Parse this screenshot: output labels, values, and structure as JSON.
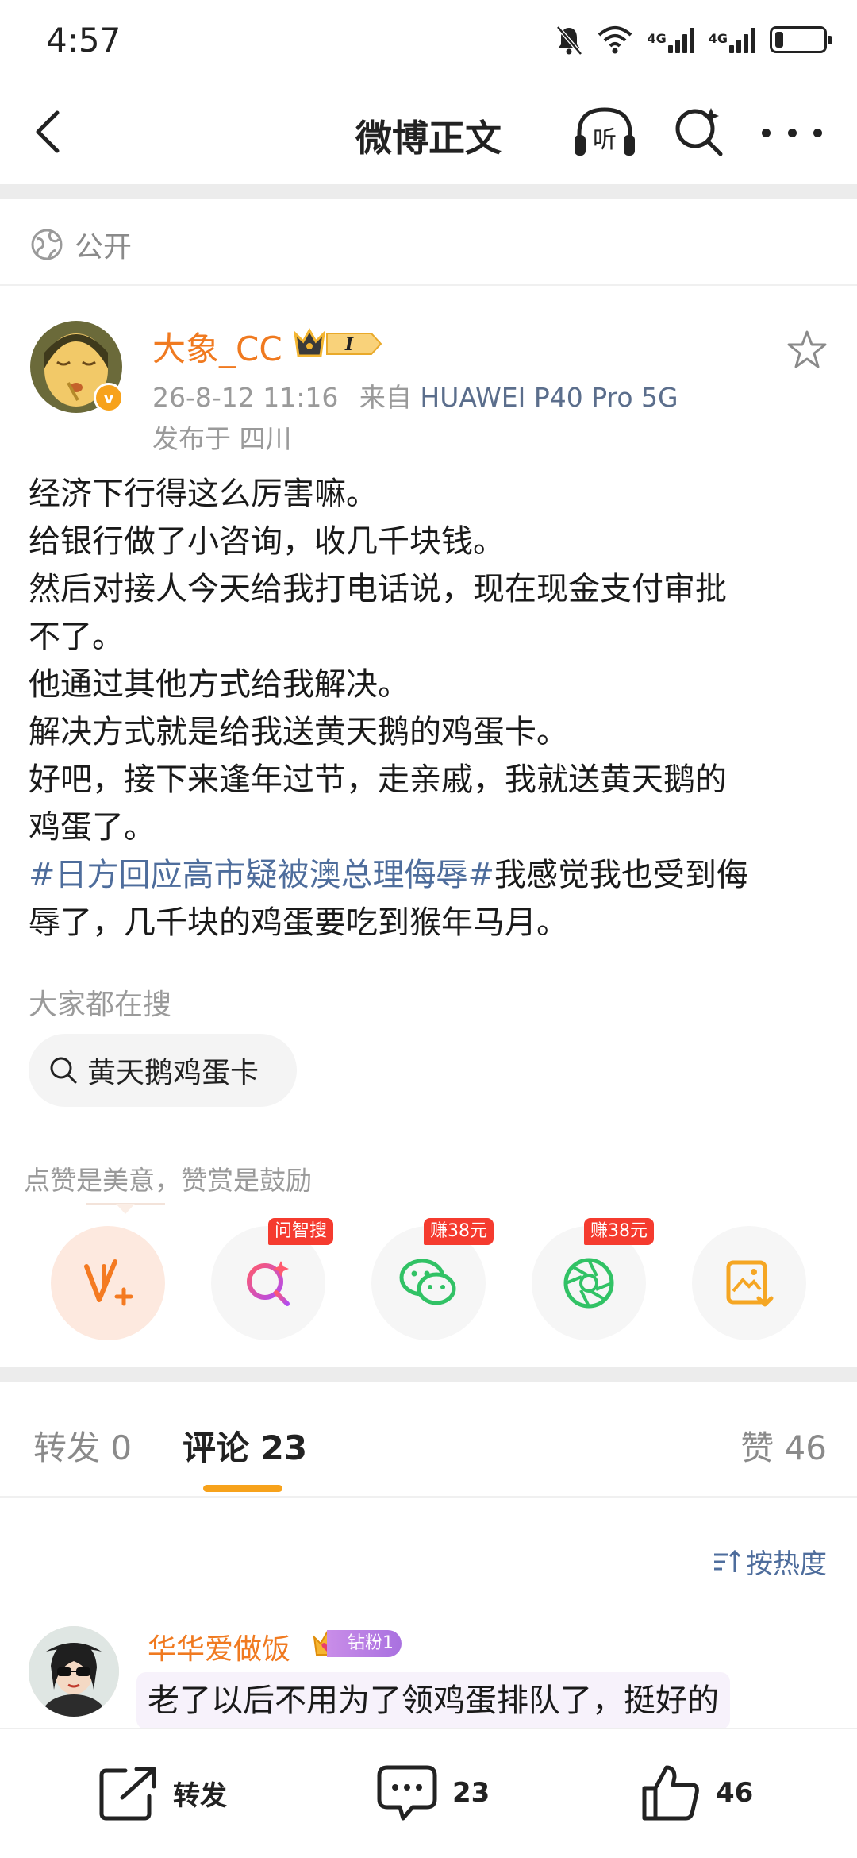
{
  "status_bar": {
    "time": "4:57",
    "network_1": "4G",
    "network_2": "4G"
  },
  "nav": {
    "title": "微博正文",
    "listen_label": "听"
  },
  "visibility": {
    "label": "公开"
  },
  "author": {
    "name": "大象_CC",
    "vip_level": "I",
    "verified_badge": "v",
    "timestamp": "26-8-12 11:16",
    "source_prefix": "来自",
    "device": "HUAWEI P40 Pro 5G",
    "location": "发布于 四川"
  },
  "post": {
    "lines": [
      "经济下行得这么厉害嘛。",
      "给银行做了小咨询，收几千块钱。",
      "然后对接人今天给我打电话说，现在现金支付审批",
      "不了。",
      "他通过其他方式给我解决。",
      "解决方式就是给我送黄天鹅的鸡蛋卡。",
      "好吧，接下来逢年过节，走亲戚，我就送黄天鹅的",
      "鸡蛋了。"
    ],
    "hashtag": "#日方回应高市疑被澳总理侮辱#",
    "after_hashtag": "我感觉我也受到侮",
    "last_line": "辱了，几千块的鸡蛋要吃到猴年马月。"
  },
  "trending": {
    "label": "大家都在搜",
    "chip": "黄天鹅鸡蛋卡"
  },
  "reward": {
    "text": "点赞是美意，赞赏是鼓励"
  },
  "share": {
    "tag_ask": "问智搜",
    "tag_wechat": "赚38元",
    "tag_moments": "赚38元"
  },
  "tabs": {
    "repost": "转发 0",
    "comments": "评论 23",
    "likes": "赞 46"
  },
  "sort": {
    "label": "按热度"
  },
  "comment": {
    "author": "华华爱做饭",
    "fan_badge": "钻粉1",
    "text": "老了以后不用为了领鸡蛋排队了，挺好的"
  },
  "bottom_bar": {
    "repost_label": "转发",
    "comment_count": "23",
    "like_count": "46"
  },
  "colors": {
    "accent_orange": "#f07a20",
    "link_blue": "#4e6d9c",
    "tab_indicator": "#f7a21b",
    "red_tag": "#f53b2f"
  }
}
